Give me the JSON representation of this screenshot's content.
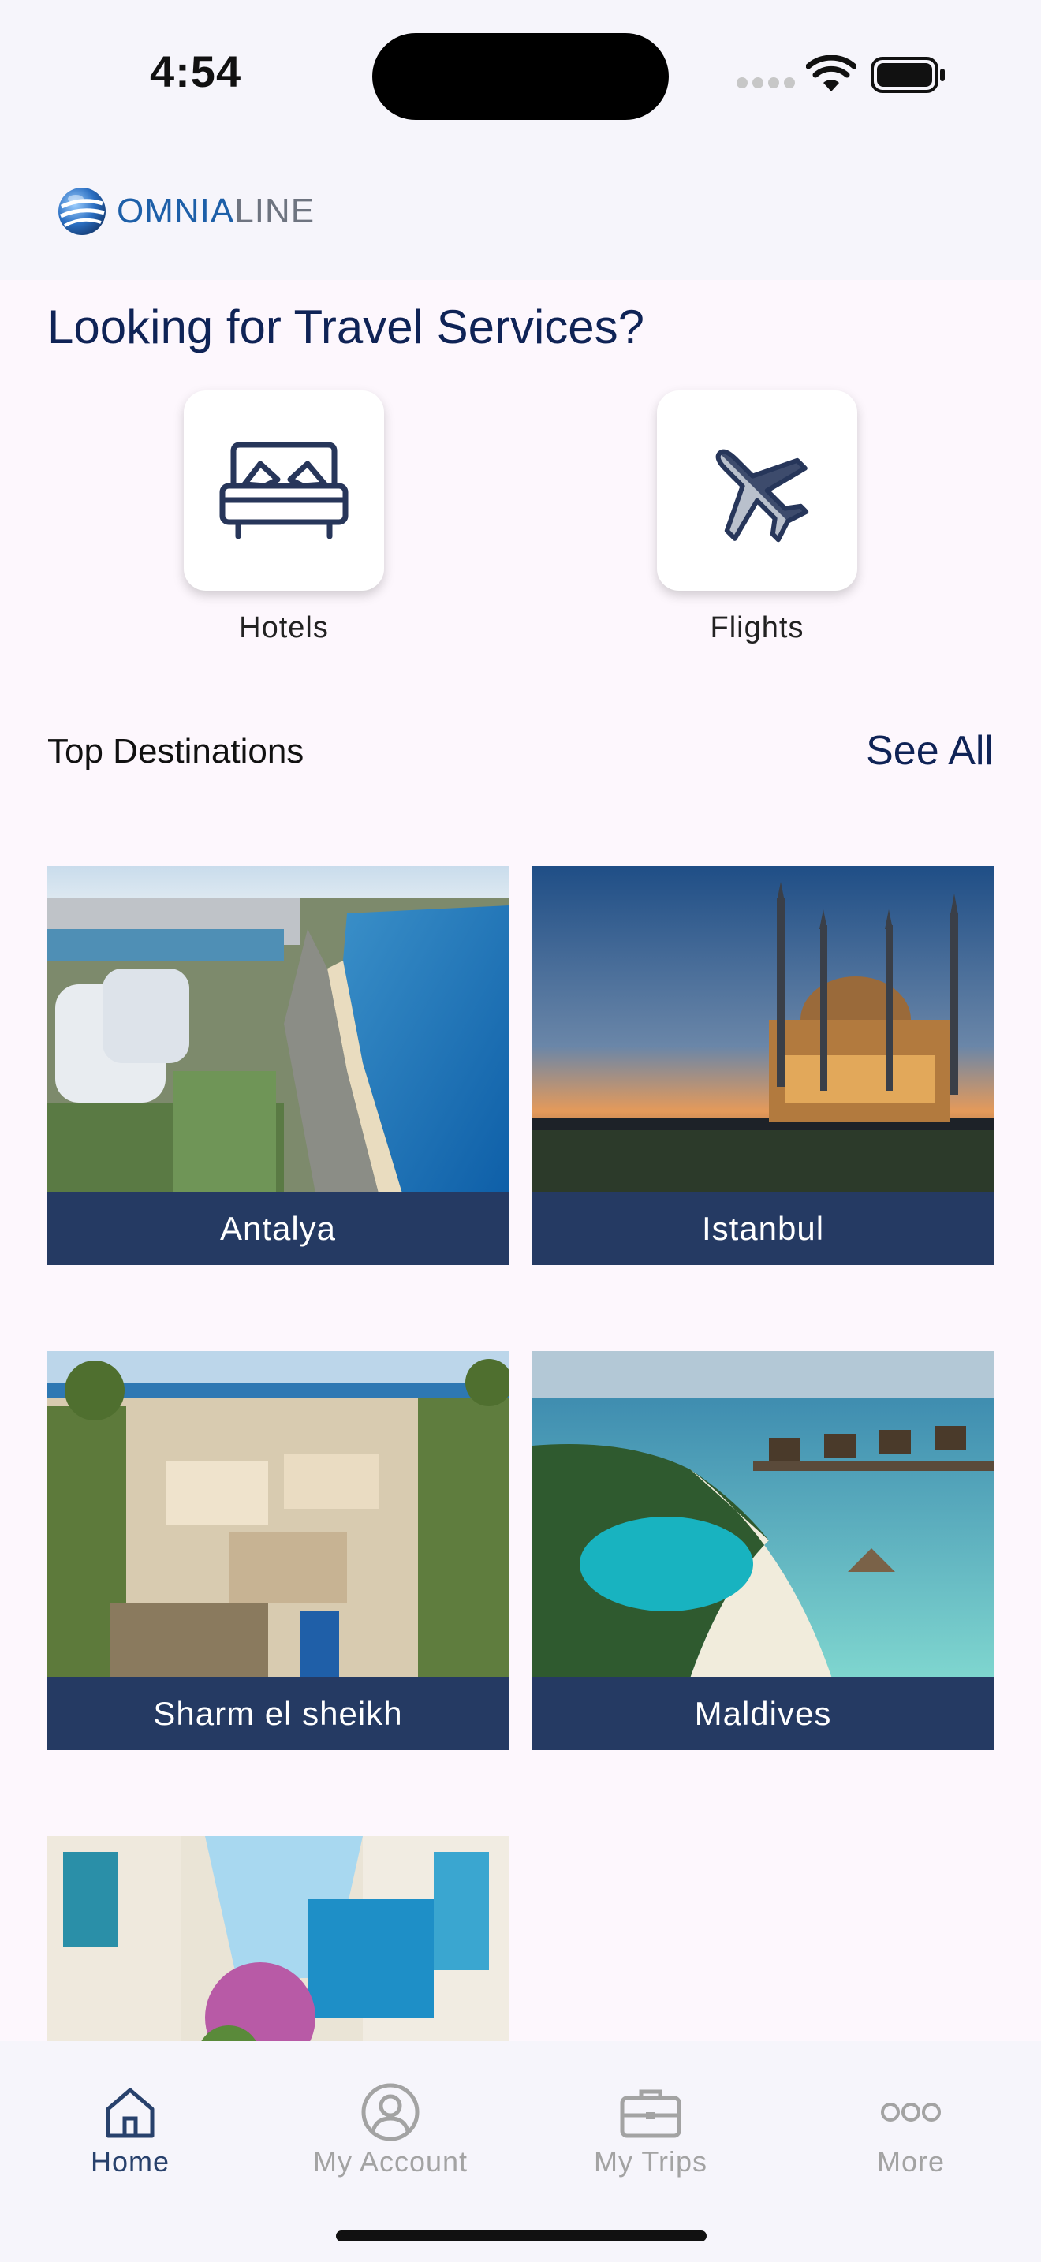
{
  "status_bar": {
    "time": "4:54"
  },
  "header": {
    "logo_text_a": "OMNIA",
    "logo_text_b": "LINE"
  },
  "services": {
    "title": "Looking for Travel Services?",
    "items": [
      {
        "label": "Hotels",
        "icon": "bed-icon"
      },
      {
        "label": "Flights",
        "icon": "airplane-icon"
      }
    ]
  },
  "destinations": {
    "heading": "Top Destinations",
    "see_all": "See All",
    "items": [
      {
        "name": "Antalya"
      },
      {
        "name": "Istanbul"
      },
      {
        "name": "Sharm el sheikh"
      },
      {
        "name": "Maldives"
      },
      {
        "name": ""
      }
    ]
  },
  "tab_bar": {
    "items": [
      {
        "label": "Home",
        "icon": "home-icon",
        "active": true
      },
      {
        "label": "My Account",
        "icon": "account-icon",
        "active": false
      },
      {
        "label": "My Trips",
        "icon": "briefcase-icon",
        "active": false
      },
      {
        "label": "More",
        "icon": "more-icon",
        "active": false
      }
    ]
  },
  "colors": {
    "primary": "#0f2356",
    "label_bg": "#253a63",
    "background": "#fdf7fd",
    "inactive_tab": "#a3a3a3"
  }
}
